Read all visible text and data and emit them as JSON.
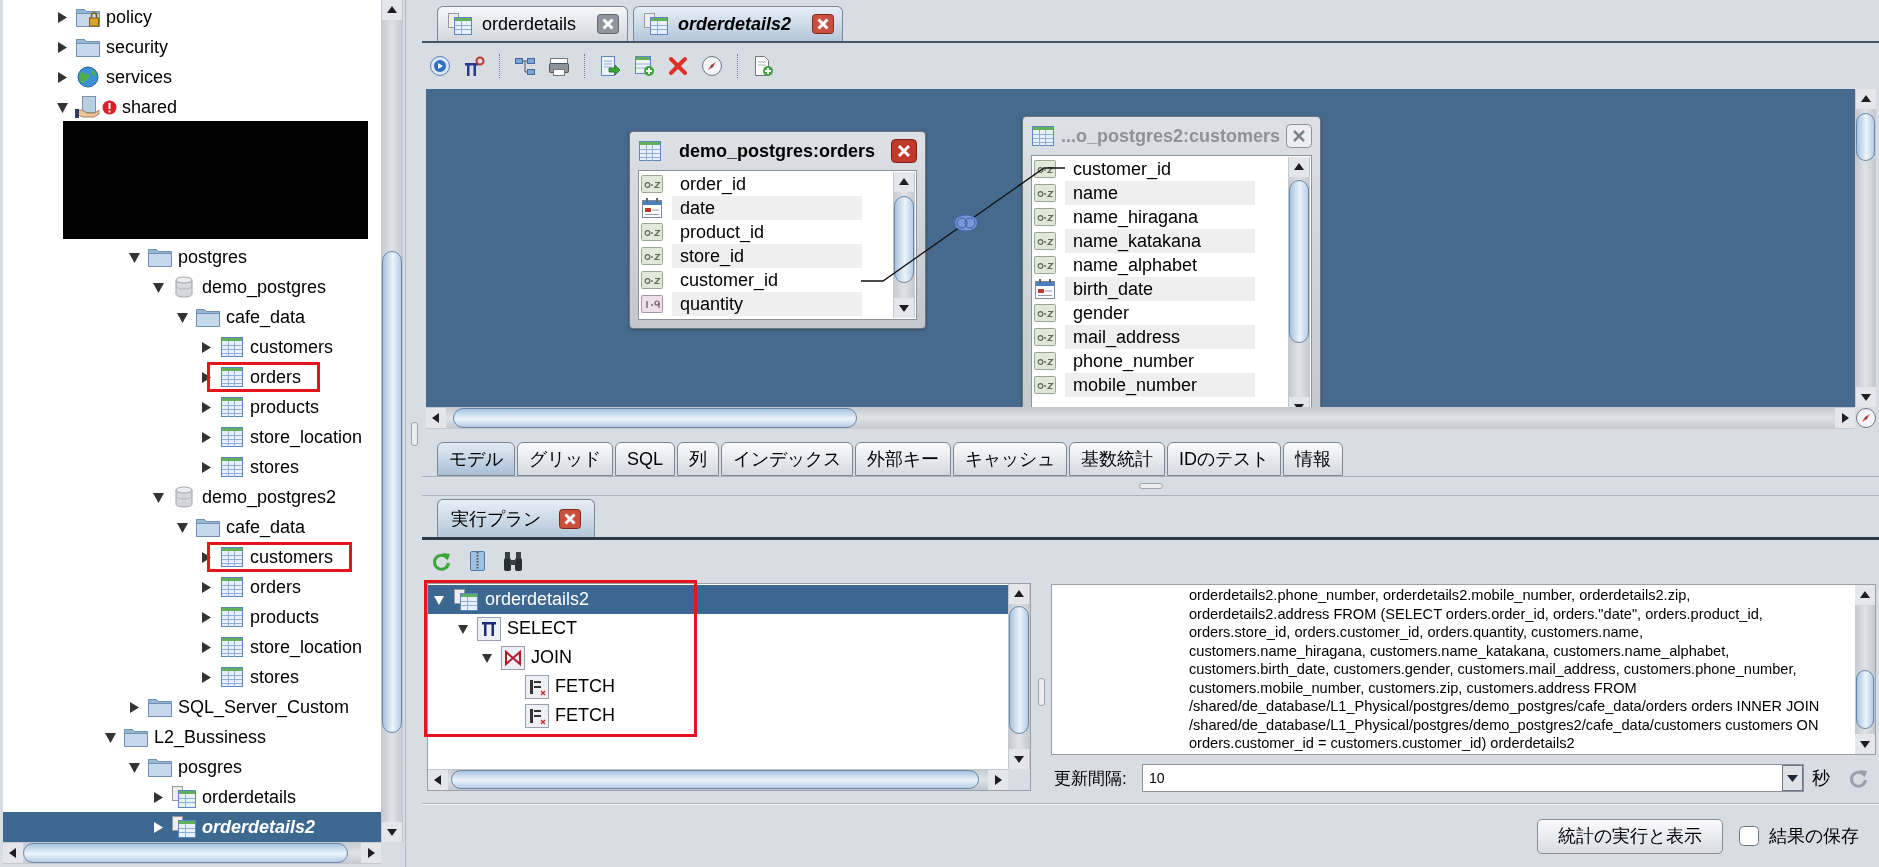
{
  "explorer": {
    "tree": [
      {
        "label": "policy",
        "kind": "locked-folder",
        "expanded": false,
        "selected": false,
        "highlighted": false
      },
      {
        "label": "security",
        "kind": "folder",
        "expanded": false,
        "selected": false,
        "highlighted": false
      },
      {
        "label": "services",
        "kind": "globe",
        "expanded": false,
        "selected": false,
        "highlighted": false
      },
      {
        "label": "shared",
        "kind": "shared",
        "expanded": true,
        "selected": false,
        "highlighted": false,
        "children": [
          {
            "kind": "hidden",
            "children": [
              {
                "kind": "hidden",
                "children": [
                  {
                    "label": "postgres",
                    "kind": "folder",
                    "expanded": true,
                    "selected": false,
                    "highlighted": false,
                    "children": [
                      {
                        "label": "demo_postgres",
                        "kind": "database",
                        "expanded": true,
                        "selected": false,
                        "highlighted": false,
                        "children": [
                          {
                            "label": "cafe_data",
                            "kind": "folder",
                            "expanded": true,
                            "selected": false,
                            "highlighted": false,
                            "children": [
                              {
                                "label": "customers",
                                "kind": "table",
                                "expanded": false,
                                "selected": false,
                                "highlighted": false
                              },
                              {
                                "label": "orders",
                                "kind": "table",
                                "expanded": false,
                                "selected": false,
                                "highlighted": true
                              },
                              {
                                "label": "products",
                                "kind": "table",
                                "expanded": false,
                                "selected": false,
                                "highlighted": false
                              },
                              {
                                "label": "store_location",
                                "kind": "table",
                                "expanded": false,
                                "selected": false,
                                "highlighted": false
                              },
                              {
                                "label": "stores",
                                "kind": "table",
                                "expanded": false,
                                "selected": false,
                                "highlighted": false
                              }
                            ]
                          }
                        ]
                      },
                      {
                        "label": "demo_postgres2",
                        "kind": "database",
                        "expanded": true,
                        "selected": false,
                        "highlighted": false,
                        "children": [
                          {
                            "label": "cafe_data",
                            "kind": "folder",
                            "expanded": true,
                            "selected": false,
                            "highlighted": false,
                            "children": [
                              {
                                "label": "customers",
                                "kind": "table",
                                "expanded": false,
                                "selected": false,
                                "highlighted": true
                              },
                              {
                                "label": "orders",
                                "kind": "table",
                                "expanded": false,
                                "selected": false,
                                "highlighted": false
                              },
                              {
                                "label": "products",
                                "kind": "table",
                                "expanded": false,
                                "selected": false,
                                "highlighted": false
                              },
                              {
                                "label": "store_location",
                                "kind": "table",
                                "expanded": false,
                                "selected": false,
                                "highlighted": false
                              },
                              {
                                "label": "stores",
                                "kind": "table",
                                "expanded": false,
                                "selected": false,
                                "highlighted": false
                              }
                            ]
                          }
                        ]
                      }
                    ]
                  },
                  {
                    "label": "SQL_Server_Custom",
                    "kind": "folder",
                    "expanded": false,
                    "selected": false,
                    "highlighted": false
                  }
                ]
              },
              {
                "label": "L2_Bussiness",
                "kind": "folder",
                "expanded": true,
                "selected": false,
                "highlighted": false,
                "children": [
                  {
                    "label": "posgres",
                    "kind": "folder",
                    "expanded": true,
                    "selected": false,
                    "highlighted": false,
                    "children": [
                      {
                        "label": "orderdetails",
                        "kind": "view",
                        "expanded": false,
                        "selected": false,
                        "highlighted": false
                      },
                      {
                        "label": "orderdetails2",
                        "kind": "view",
                        "expanded": false,
                        "selected": true,
                        "highlighted": false
                      }
                    ]
                  }
                ]
              }
            ]
          }
        ]
      }
    ]
  },
  "editor_tabs": [
    {
      "label": "orderdetails",
      "selected": false
    },
    {
      "label": "orderdetails2",
      "selected": true
    }
  ],
  "canvas": {
    "tables": [
      {
        "title": "demo_postgres:orders",
        "active": true,
        "columns": [
          {
            "name": "order_id",
            "kind": "text"
          },
          {
            "name": "date",
            "kind": "date"
          },
          {
            "name": "product_id",
            "kind": "text"
          },
          {
            "name": "store_id",
            "kind": "text"
          },
          {
            "name": "customer_id",
            "kind": "text"
          },
          {
            "name": "quantity",
            "kind": "number"
          }
        ]
      },
      {
        "title": "...o_postgres2:customers",
        "active": false,
        "columns": [
          {
            "name": "customer_id",
            "kind": "text"
          },
          {
            "name": "name",
            "kind": "text"
          },
          {
            "name": "name_hiragana",
            "kind": "text"
          },
          {
            "name": "name_katakana",
            "kind": "text"
          },
          {
            "name": "name_alphabet",
            "kind": "text"
          },
          {
            "name": "birth_date",
            "kind": "date"
          },
          {
            "name": "gender",
            "kind": "text"
          },
          {
            "name": "mail_address",
            "kind": "text"
          },
          {
            "name": "phone_number",
            "kind": "text"
          },
          {
            "name": "mobile_number",
            "kind": "text"
          }
        ]
      }
    ]
  },
  "view_tabs": [
    {
      "label": "モデル",
      "selected": true
    },
    {
      "label": "グリッド",
      "selected": false
    },
    {
      "label": "SQL",
      "selected": false
    },
    {
      "label": "列",
      "selected": false
    },
    {
      "label": "インデックス",
      "selected": false
    },
    {
      "label": "外部キー",
      "selected": false
    },
    {
      "label": "キャッシュ",
      "selected": false
    },
    {
      "label": "基数統計",
      "selected": false
    },
    {
      "label": "IDのテスト",
      "selected": false
    },
    {
      "label": "情報",
      "selected": false
    }
  ],
  "plan": {
    "tab": "実行プラン",
    "highlighted": true,
    "tree": [
      {
        "label": "orderdetails2",
        "kind": "view",
        "expanded": true,
        "selected": true,
        "children": [
          {
            "label": "SELECT",
            "kind": "select",
            "expanded": true,
            "selected": false,
            "children": [
              {
                "label": "JOIN",
                "kind": "join",
                "expanded": true,
                "selected": false,
                "children": [
                  {
                    "label": "FETCH",
                    "kind": "fetch",
                    "selected": false
                  },
                  {
                    "label": "FETCH",
                    "kind": "fetch",
                    "selected": false
                  }
                ]
              }
            ]
          }
        ]
      }
    ],
    "sql_text": "orderdetails2.phone_number, orderdetails2.mobile_number, orderdetails2.zip,\norderdetails2.address FROM (SELECT orders.order_id, orders.\"date\", orders.product_id,\norders.store_id, orders.customer_id, orders.quantity, customers.name,\ncustomers.name_hiragana, customers.name_katakana, customers.name_alphabet,\ncustomers.birth_date, customers.gender, customers.mail_address, customers.phone_number,\ncustomers.mobile_number, customers.zip, customers.address FROM\n/shared/de_database/L1_Physical/postgres/demo_postgres/cafe_data/orders orders INNER JOIN\n/shared/de_database/L1_Physical/postgres/demo_postgres2/cafe_data/customers customers ON\norders.customer_id = customers.customer_id) orderdetails2",
    "refresh_interval": {
      "label": "更新間隔:",
      "value": "10",
      "unit": "秒"
    }
  },
  "run_button": "統計の実行と表示",
  "save_results": {
    "label": "結果の保存",
    "checked": false
  }
}
